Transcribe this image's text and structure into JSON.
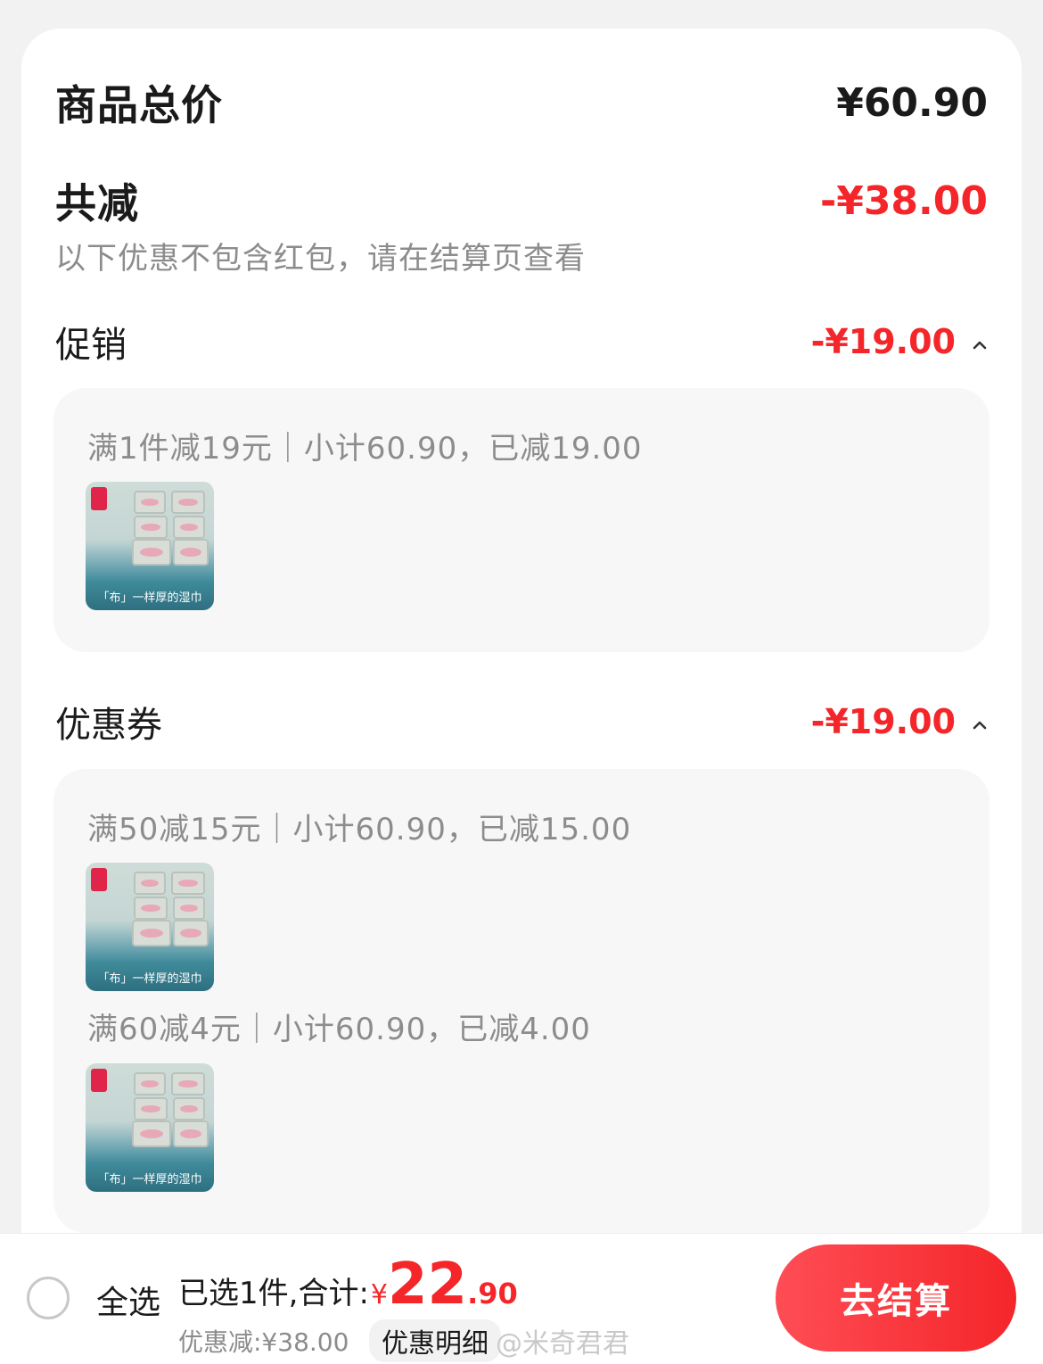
{
  "summary": {
    "total_label": "商品总价",
    "total_value": "¥60.90",
    "reduce_label": "共减",
    "reduce_value": "-¥38.00",
    "note": "以下优惠不包含红包，请在结算页查看"
  },
  "promotion": {
    "title": "促销",
    "amount": "-¥19.00",
    "rules": [
      {
        "text": "满1件减19元｜小计60.90，已减19.00",
        "thumb_caption": "「布」一样厚的湿巾"
      }
    ]
  },
  "coupon": {
    "title": "优惠券",
    "amount": "-¥19.00",
    "rules": [
      {
        "text": "满50减15元｜小计60.90，已减15.00",
        "thumb_caption": "「布」一样厚的湿巾"
      },
      {
        "text": "满60减4元｜小计60.90，已减4.00",
        "thumb_caption": "「布」一样厚的湿巾"
      }
    ]
  },
  "bottom_bar": {
    "select_all": "全选",
    "selected_label": "已选1件,合计:",
    "currency": "¥",
    "total_int": "22",
    "total_dec": ".90",
    "discount_text": "优惠减:¥38.00",
    "detail_button": "优惠明细",
    "watermark": "@米奇君君",
    "checkout_button": "去结算"
  },
  "colors": {
    "accent_red": "#f4262a",
    "muted_text": "#8c8c8c",
    "panel_bg": "#f7f7f7"
  },
  "icons": {
    "collapse": "chevron-up-icon",
    "select": "radio-unchecked-icon"
  }
}
